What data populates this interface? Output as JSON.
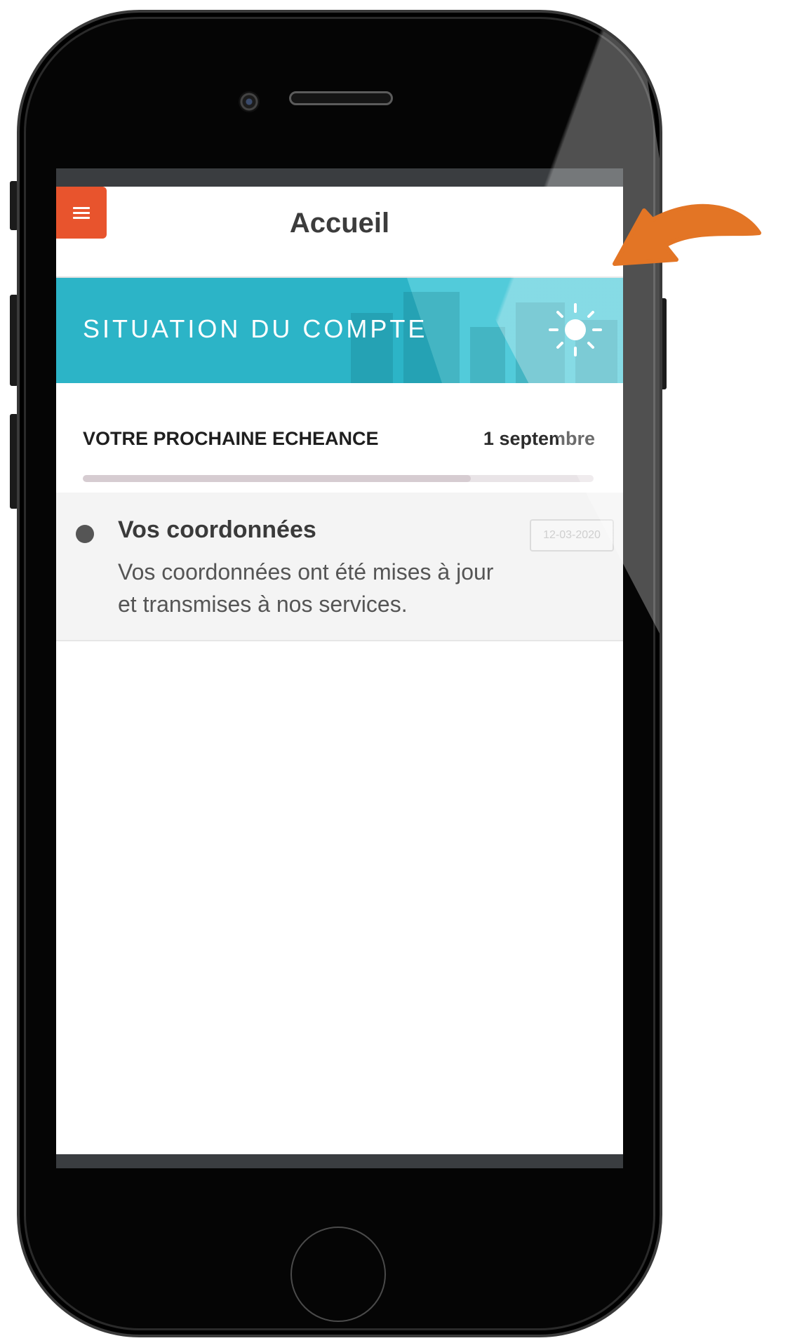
{
  "header": {
    "title": "Accueil",
    "menu_icon": "hamburger-icon"
  },
  "banner": {
    "title": "SITUATION DU COMPTE",
    "icon": "sun-icon",
    "color": "#2cb4c7"
  },
  "next_due": {
    "label": "VOTRE PROCHAINE ECHEANCE",
    "date": "1 septembre",
    "progress": 0.76
  },
  "activity": [
    {
      "title": "Vos coordonnées",
      "text": "Vos coordonnées ont été mises à jour et transmises à nos services.",
      "date": "12-03-2020"
    }
  ],
  "colors": {
    "accent": "#e8542d",
    "arrow": "#e37525",
    "banner": "#2cb4c7"
  }
}
